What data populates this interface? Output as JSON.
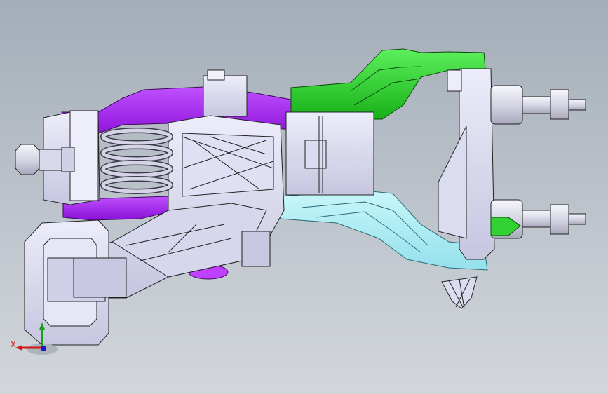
{
  "viewport": {
    "background_top": "#a4adb8",
    "background_bottom": "#d3d7dc"
  },
  "model": {
    "part_colors": {
      "bracket": "#d8d8ee",
      "purple_arm": "#a020f0",
      "green_arm": "#22cc22",
      "cyan_arm": "#a8ecf4",
      "spring": "#c8c8d8",
      "green_nut": "#33d233"
    }
  },
  "triad": {
    "x_axis_label": "X",
    "x_color": "#d01818",
    "y_color": "#18a018",
    "z_color": "#1818c8"
  }
}
